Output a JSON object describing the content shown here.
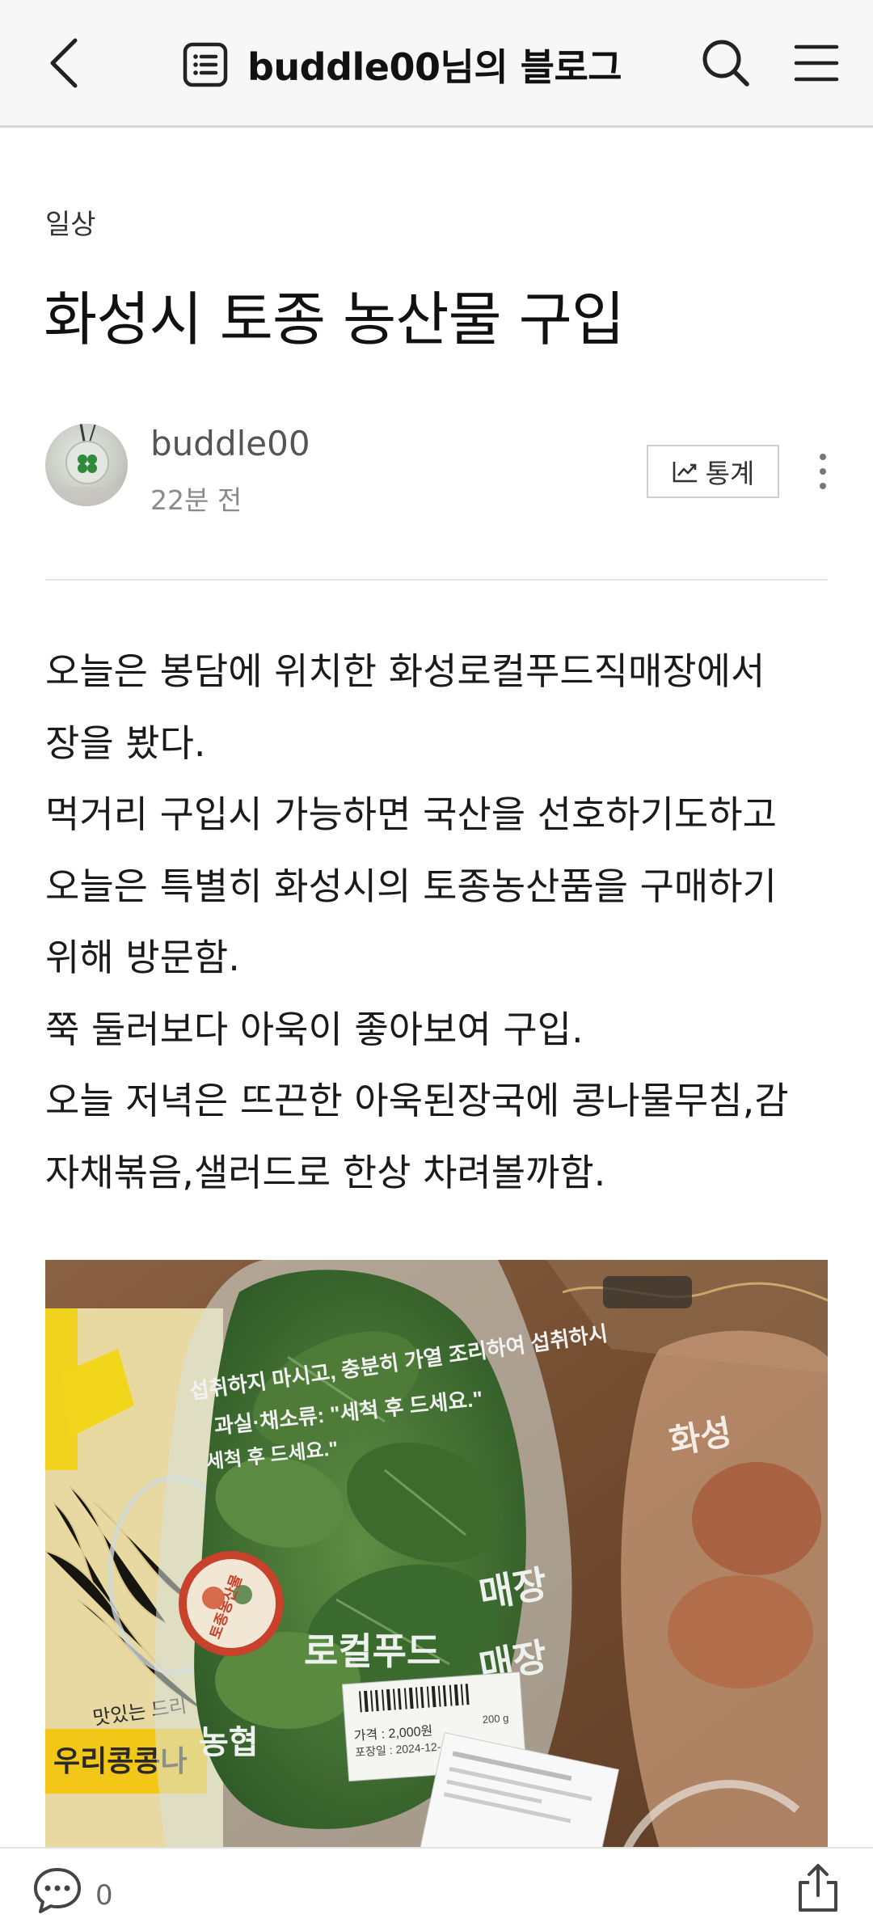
{
  "header": {
    "back_icon": "chevron-left-icon",
    "blog_icon": "list-document-icon",
    "title": "buddle00님의 블로그",
    "search_icon": "search-icon",
    "menu_icon": "hamburger-menu-icon"
  },
  "post": {
    "category": "일상",
    "title": "화성시 토종 농산물 구입",
    "author": {
      "name": "buddle00",
      "time": "22분 전"
    },
    "stats_label": "통계",
    "body_lines": [
      "오늘은 봉담에 위치한 화성로컬푸드직매장에서",
      "장을 봤다.",
      "먹거리 구입시 가능하면 국산을 선호하기도하고",
      "오늘은 특별히 화성시의 토종농산품을 구매하기",
      "위해 방문함.",
      "쭉 둘러보다 아욱이 좋아보여 구입.",
      "오늘 저녁은 뜨끈한 아욱된장국에 콩나물무침,감",
      "자채볶음,샐러드로 한상 차려볼까함."
    ]
  },
  "photo": {
    "bag_text": [
      "섭취하지 마시고, 충분히 가열 조리하여 섭취하시",
      "과실·채소류: \"세척 후 드세요.\"",
      "세척 후 드세요.\""
    ],
    "sticker_text": "토종농산물",
    "bag_brand_text": "로컬푸드",
    "store_text": "매장",
    "nh_text": "농협",
    "left_pkg_text": "우리콩콩나",
    "left_pkg_top": "맛있는 드리",
    "right_bag_text": "화성",
    "label": {
      "price": "가격 : 2,000원",
      "date": "포장일 : 2024-12-10",
      "weight": "200 g"
    }
  },
  "bottom": {
    "comment_count": "0"
  },
  "colors": {
    "header_bg": "#f7f7f7",
    "text": "#111111",
    "muted": "#8a8a8a"
  }
}
